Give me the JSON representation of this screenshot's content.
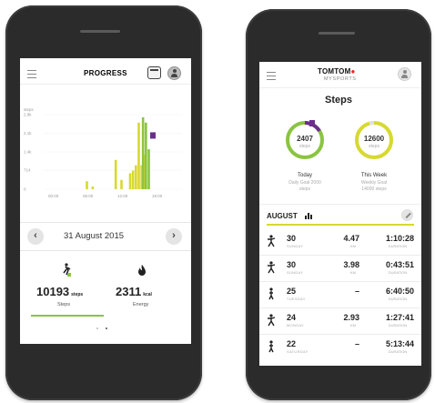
{
  "colors": {
    "accent_green": "#8bc441",
    "accent_yellow": "#d7d92f",
    "goal_purple": "#6b2f8a"
  },
  "left_app": {
    "header": {
      "title": "PROGRESS",
      "menu_icon": "hamburger-icon",
      "calendar_icon": "calendar-icon",
      "profile_icon": "user-icon"
    },
    "chart": {
      "ylabel": "steps",
      "y_ticks": [
        "2.8k",
        "2.1k",
        "1.4k",
        "714",
        "0"
      ],
      "x_ticks": [
        "00:00",
        "06:00",
        "12:00",
        "18:00"
      ]
    },
    "date_nav": {
      "date": "31 August 2015",
      "prev_glyph": "‹",
      "next_glyph": "›"
    },
    "metrics": [
      {
        "value": "10193",
        "unit": "steps",
        "label": "Steps",
        "icon": "walking-icon"
      },
      {
        "value": "2311",
        "unit": "kcal",
        "label": "Energy",
        "icon": "flame-icon"
      }
    ],
    "pager_dots": 2
  },
  "right_app": {
    "header": {
      "logo": "TOMTOM",
      "logo_sub": "MYSPORTS",
      "menu_icon": "hamburger-icon",
      "profile_icon": "user-icon"
    },
    "title": "Steps",
    "rings": [
      {
        "value": "2407",
        "unit": "steps",
        "label": "Today",
        "sublabel_1": "Daily Goal 2000",
        "sublabel_2": "steps",
        "progress": 1.0
      },
      {
        "value": "12600",
        "unit": "steps",
        "label": "This Week",
        "sublabel_1": "Weekly Goal",
        "sublabel_2": "14000 steps",
        "progress": 0.9
      }
    ],
    "month_section": {
      "label": "AUGUST",
      "edit_icon": "pencil-icon"
    },
    "rows": [
      {
        "day": "30",
        "weekday": "SUNDAY",
        "km": "4.47",
        "km_unit": "KM",
        "duration": "1:10:28",
        "duration_unit": "DURATION",
        "icon": "running-icon"
      },
      {
        "day": "30",
        "weekday": "SUNDAY",
        "km": "3.98",
        "km_unit": "KM",
        "duration": "0:43:51",
        "duration_unit": "DURATION",
        "icon": "running-icon"
      },
      {
        "day": "25",
        "weekday": "TUESDAY",
        "km": "–",
        "km_unit": "",
        "duration": "6:40:50",
        "duration_unit": "DURATION",
        "icon": "walking-icon"
      },
      {
        "day": "24",
        "weekday": "MONDAY",
        "km": "2.93",
        "km_unit": "KM",
        "duration": "1:27:41",
        "duration_unit": "DURATION",
        "icon": "running-icon"
      },
      {
        "day": "22",
        "weekday": "SATURDAY",
        "km": "–",
        "km_unit": "",
        "duration": "5:13:44",
        "duration_unit": "DURATION",
        "icon": "walking-icon"
      }
    ]
  },
  "chart_data": {
    "type": "bar",
    "title": "",
    "xlabel": "",
    "ylabel": "steps",
    "y_ticks": [
      "0",
      "714",
      "1.4k",
      "2.1k",
      "2.8k"
    ],
    "x_ticks": [
      "00:00",
      "06:00",
      "12:00",
      "18:00"
    ],
    "x": [
      7.5,
      8.5,
      12.5,
      13.5,
      15.0,
      15.5,
      16.0,
      16.5,
      17.0,
      17.5,
      18.0
    ],
    "ylim": [
      0,
      2800
    ],
    "xlim": [
      0,
      24
    ],
    "series": [
      {
        "color": "#d7d92f",
        "values": [
          300,
          100,
          1100,
          350,
          600,
          700,
          900,
          2500,
          900,
          1300,
          0
        ]
      },
      {
        "color": "#8bc441",
        "values": [
          0,
          0,
          0,
          0,
          0,
          0,
          0,
          0,
          2700,
          2500,
          1500
        ]
      }
    ],
    "goal_marker_x": 18.0
  }
}
